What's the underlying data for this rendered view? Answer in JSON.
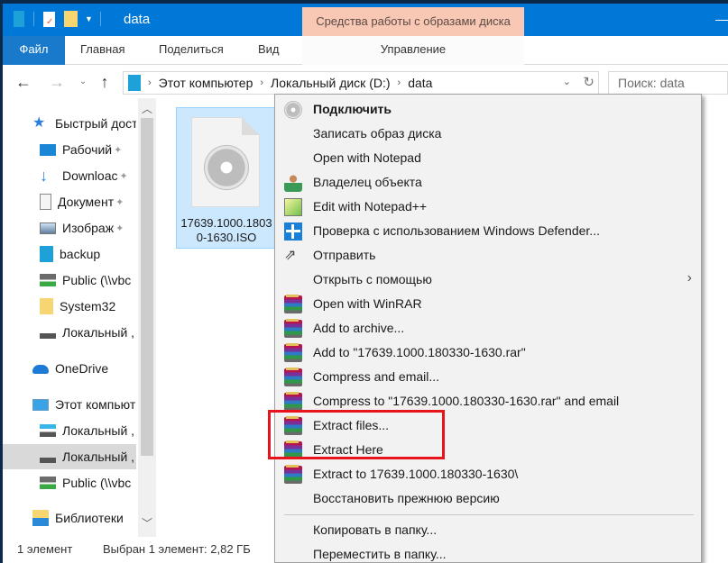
{
  "window": {
    "title": "data",
    "contextual_group": "Средства работы с образами диска"
  },
  "ribbon": {
    "tabs": [
      {
        "label": "Файл",
        "active": true
      },
      {
        "label": "Главная"
      },
      {
        "label": "Поделиться"
      },
      {
        "label": "Вид"
      },
      {
        "label": "Управление"
      }
    ]
  },
  "navigation": {
    "breadcrumb": [
      "Этот компьютер",
      "Локальный диск (D:)",
      "data"
    ],
    "search_placeholder": "Поиск: data",
    "icons": {
      "back": "arrow-left-icon",
      "forward": "arrow-right-icon",
      "recent": "chevron-down-icon",
      "up": "arrow-up-icon",
      "refresh": "refresh-icon"
    }
  },
  "sidebar": {
    "items": [
      {
        "label": "Быстрый дост",
        "icon": "star-icon",
        "level": 0
      },
      {
        "label": "Рабочий",
        "icon": "desktop-icon",
        "level": 1,
        "pinned": true
      },
      {
        "label": "Downloac",
        "icon": "download-icon",
        "level": 1,
        "pinned": true
      },
      {
        "label": "Документ",
        "icon": "document-icon",
        "level": 1,
        "pinned": true
      },
      {
        "label": "Изображ",
        "icon": "pictures-icon",
        "level": 1,
        "pinned": true
      },
      {
        "label": "backup",
        "icon": "folder-blue-icon",
        "level": 1
      },
      {
        "label": "Public (\\\\vbc",
        "icon": "network-drive-icon",
        "level": 1
      },
      {
        "label": "System32",
        "icon": "folder-icon",
        "level": 1
      },
      {
        "label": "Локальный ,",
        "icon": "drive-icon",
        "level": 1
      },
      {
        "label": "OneDrive",
        "icon": "onedrive-icon",
        "level": 0
      },
      {
        "label": "Этот компьют",
        "icon": "computer-icon",
        "level": 0
      },
      {
        "label": "Локальный ,",
        "icon": "windows-drive-icon",
        "level": 1
      },
      {
        "label": "Локальный ,",
        "icon": "drive-icon",
        "level": 1,
        "selected": true
      },
      {
        "label": "Public (\\\\vbc",
        "icon": "network-drive-icon",
        "level": 1
      },
      {
        "label": "Библиотеки",
        "icon": "libraries-icon",
        "level": 0
      }
    ]
  },
  "files": [
    {
      "name_line1": "17639.1000.1803",
      "name_line2": "0-1630.ISO",
      "icon": "disc-image-icon",
      "selected": true
    }
  ],
  "status_bar": {
    "count": "1 элемент",
    "selection": "Выбран 1 элемент: 2,82 ГБ"
  },
  "context_menu": {
    "items": [
      {
        "label": "Подключить",
        "icon": "disc-icon",
        "bold": true
      },
      {
        "label": "Записать образ диска",
        "icon": ""
      },
      {
        "label": "Open with Notepad",
        "icon": ""
      },
      {
        "label": "Владелец объекта",
        "icon": "owner-icon"
      },
      {
        "label": "Edit with Notepad++",
        "icon": "notepadpp-icon"
      },
      {
        "label": "Проверка с использованием Windows Defender...",
        "icon": "defender-icon"
      },
      {
        "label": "Отправить",
        "icon": "share-icon"
      },
      {
        "label": "Открыть с помощью",
        "icon": "",
        "submenu": true
      },
      {
        "label": "Open with WinRAR",
        "icon": "winrar-icon"
      },
      {
        "label": "Add to archive...",
        "icon": "winrar-icon"
      },
      {
        "label": "Add to \"17639.1000.180330-1630.rar\"",
        "icon": "winrar-icon"
      },
      {
        "label": "Compress and email...",
        "icon": "winrar-icon"
      },
      {
        "label": "Compress to \"17639.1000.180330-1630.rar\" and email",
        "icon": "winrar-icon"
      },
      {
        "label": "Extract files...",
        "icon": "winrar-icon",
        "highlighted": true
      },
      {
        "label": "Extract Here",
        "icon": "winrar-icon",
        "highlighted": true
      },
      {
        "label": "Extract to 17639.1000.180330-1630\\",
        "icon": "winrar-icon"
      },
      {
        "label": "Восстановить прежнюю версию",
        "icon": ""
      },
      {
        "label": "Копировать в папку...",
        "icon": ""
      },
      {
        "label": "Переместить в папку...",
        "icon": ""
      }
    ],
    "highlight_color": "#e8141b"
  },
  "colors": {
    "titlebar": "#0078d7",
    "contextual_tab": "#f8c8b4",
    "selection": "#cce8ff"
  }
}
